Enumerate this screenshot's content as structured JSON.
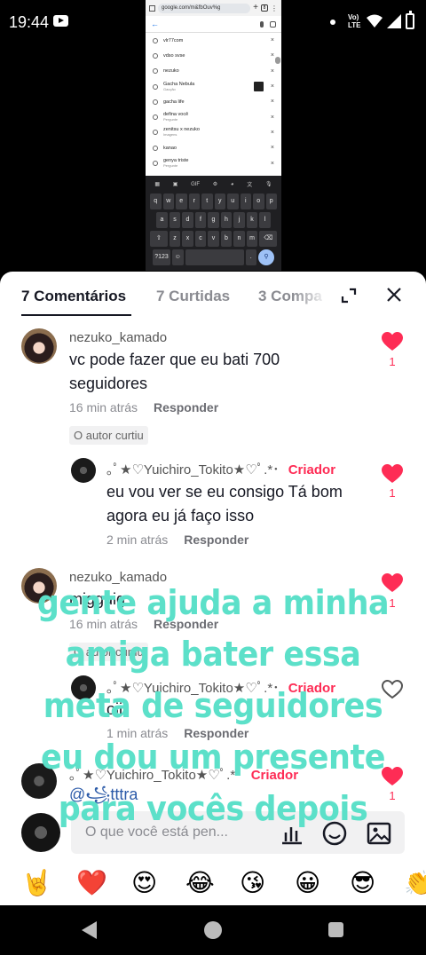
{
  "status_bar": {
    "time": "19:44",
    "network": "Vo) LTE"
  },
  "embedded_screenshot": {
    "url": "google.com/m&fbOuv%g",
    "suggestions": [
      {
        "text": "vlr77com",
        "sub": ""
      },
      {
        "text": "vdso svse",
        "sub": ""
      },
      {
        "text": "nezuko",
        "sub": ""
      },
      {
        "text": "Gacha Nebula",
        "sub": "Gacção"
      },
      {
        "text": "gacha life",
        "sub": ""
      },
      {
        "text": "defina você",
        "sub": "Pergunte"
      },
      {
        "text": "zenitsu x nezuko",
        "sub": "Imagens"
      },
      {
        "text": "kanao",
        "sub": ""
      },
      {
        "text": "genya triste",
        "sub": "Pergunte"
      }
    ],
    "keyboard_rows": [
      [
        "q",
        "w",
        "e",
        "r",
        "t",
        "y",
        "u",
        "i",
        "o",
        "p"
      ],
      [
        "a",
        "s",
        "d",
        "f",
        "g",
        "h",
        "j",
        "k",
        "l"
      ],
      [
        "⇧",
        "z",
        "x",
        "c",
        "v",
        "b",
        "n",
        "m",
        "⌫"
      ],
      [
        "?123",
        "☺",
        "",
        "."
      ]
    ]
  },
  "tabs": [
    {
      "label": "7 Comentários",
      "active": true
    },
    {
      "label": "7 Curtidas",
      "active": false
    },
    {
      "label": "3 Compa",
      "active": false
    }
  ],
  "comments": [
    {
      "user": "nezuko_kamado",
      "text": "vc pode fazer que eu bati 700 seguidores",
      "time": "16 min atrás",
      "reply_label": "Responder",
      "liked_by_author": "O autor curtiu",
      "likes": "1",
      "liked": true
    },
    {
      "user": "｡ﾟ★♡Yuichiro_Tokito★♡ﾟ.*･",
      "badge": "Criador",
      "text": "eu vou ver se eu consigo Tá bom agora eu já faço isso",
      "time": "2 min atrás",
      "reply_label": "Responder",
      "likes": "1",
      "liked": true
    },
    {
      "user": "nezuko_kamado",
      "text": "migguig",
      "time": "16 min atrás",
      "reply_label": "Responder",
      "liked_by_author": "O autor curtiu",
      "likes": "1",
      "liked": true
    },
    {
      "user": "｡ﾟ★♡Yuichiro_Tokito★♡ﾟ.*･",
      "badge": "Criador",
      "text": "oii",
      "time": "1 min atrás",
      "reply_label": "Responder",
      "likes": "",
      "liked": false
    },
    {
      "user": "｡ﾟ★♡Yuichiro_Tokito★♡ﾟ.*･",
      "badge": "Criador",
      "text": "@꧁tttra tokitinha☆",
      "likes": "1",
      "liked": true
    }
  ],
  "input": {
    "placeholder": "O que você está pen..."
  },
  "emojis": [
    "🤘",
    "❤️",
    "😍",
    "😂",
    "😘",
    "😀",
    "😎",
    "👏"
  ],
  "overlay_caption": [
    "gente ajuda a minha",
    "amiga bater essa",
    "meta de seguidores",
    "eu dou um presente",
    "para vocês depois"
  ],
  "colors": {
    "like_red": "#fe2c55",
    "overlay_text": "#5ce0c9",
    "sheet_bg": "#ffffff"
  }
}
